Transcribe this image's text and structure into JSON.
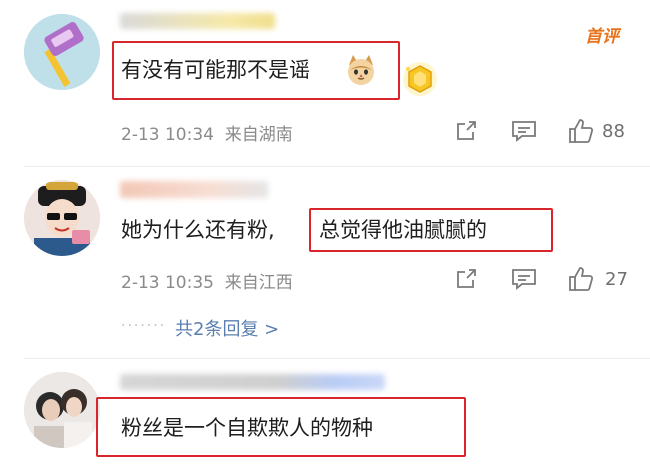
{
  "comments": [
    {
      "text": "有没有可能那不是谣",
      "date": "2-13 10:34",
      "location": "来自湖南",
      "likes": "88",
      "badge": "首评"
    },
    {
      "text_prefix": "她为什么还有粉,",
      "text_highlight": "总觉得他油腻腻的",
      "date": "2-13 10:35",
      "location": "来自江西",
      "likes": "27",
      "replies_label": "共2条回复 >"
    },
    {
      "text": "粉丝是一个自欺欺人的物种"
    }
  ],
  "colors": {
    "highlight_border": "#d9262c",
    "reply_link": "#5a7fae",
    "badge": "#e8731c",
    "meta_text": "#8a8a8a"
  },
  "icons": [
    "share-icon",
    "comment-icon",
    "like-icon",
    "cat-emoji-icon",
    "coin-badge-icon"
  ]
}
